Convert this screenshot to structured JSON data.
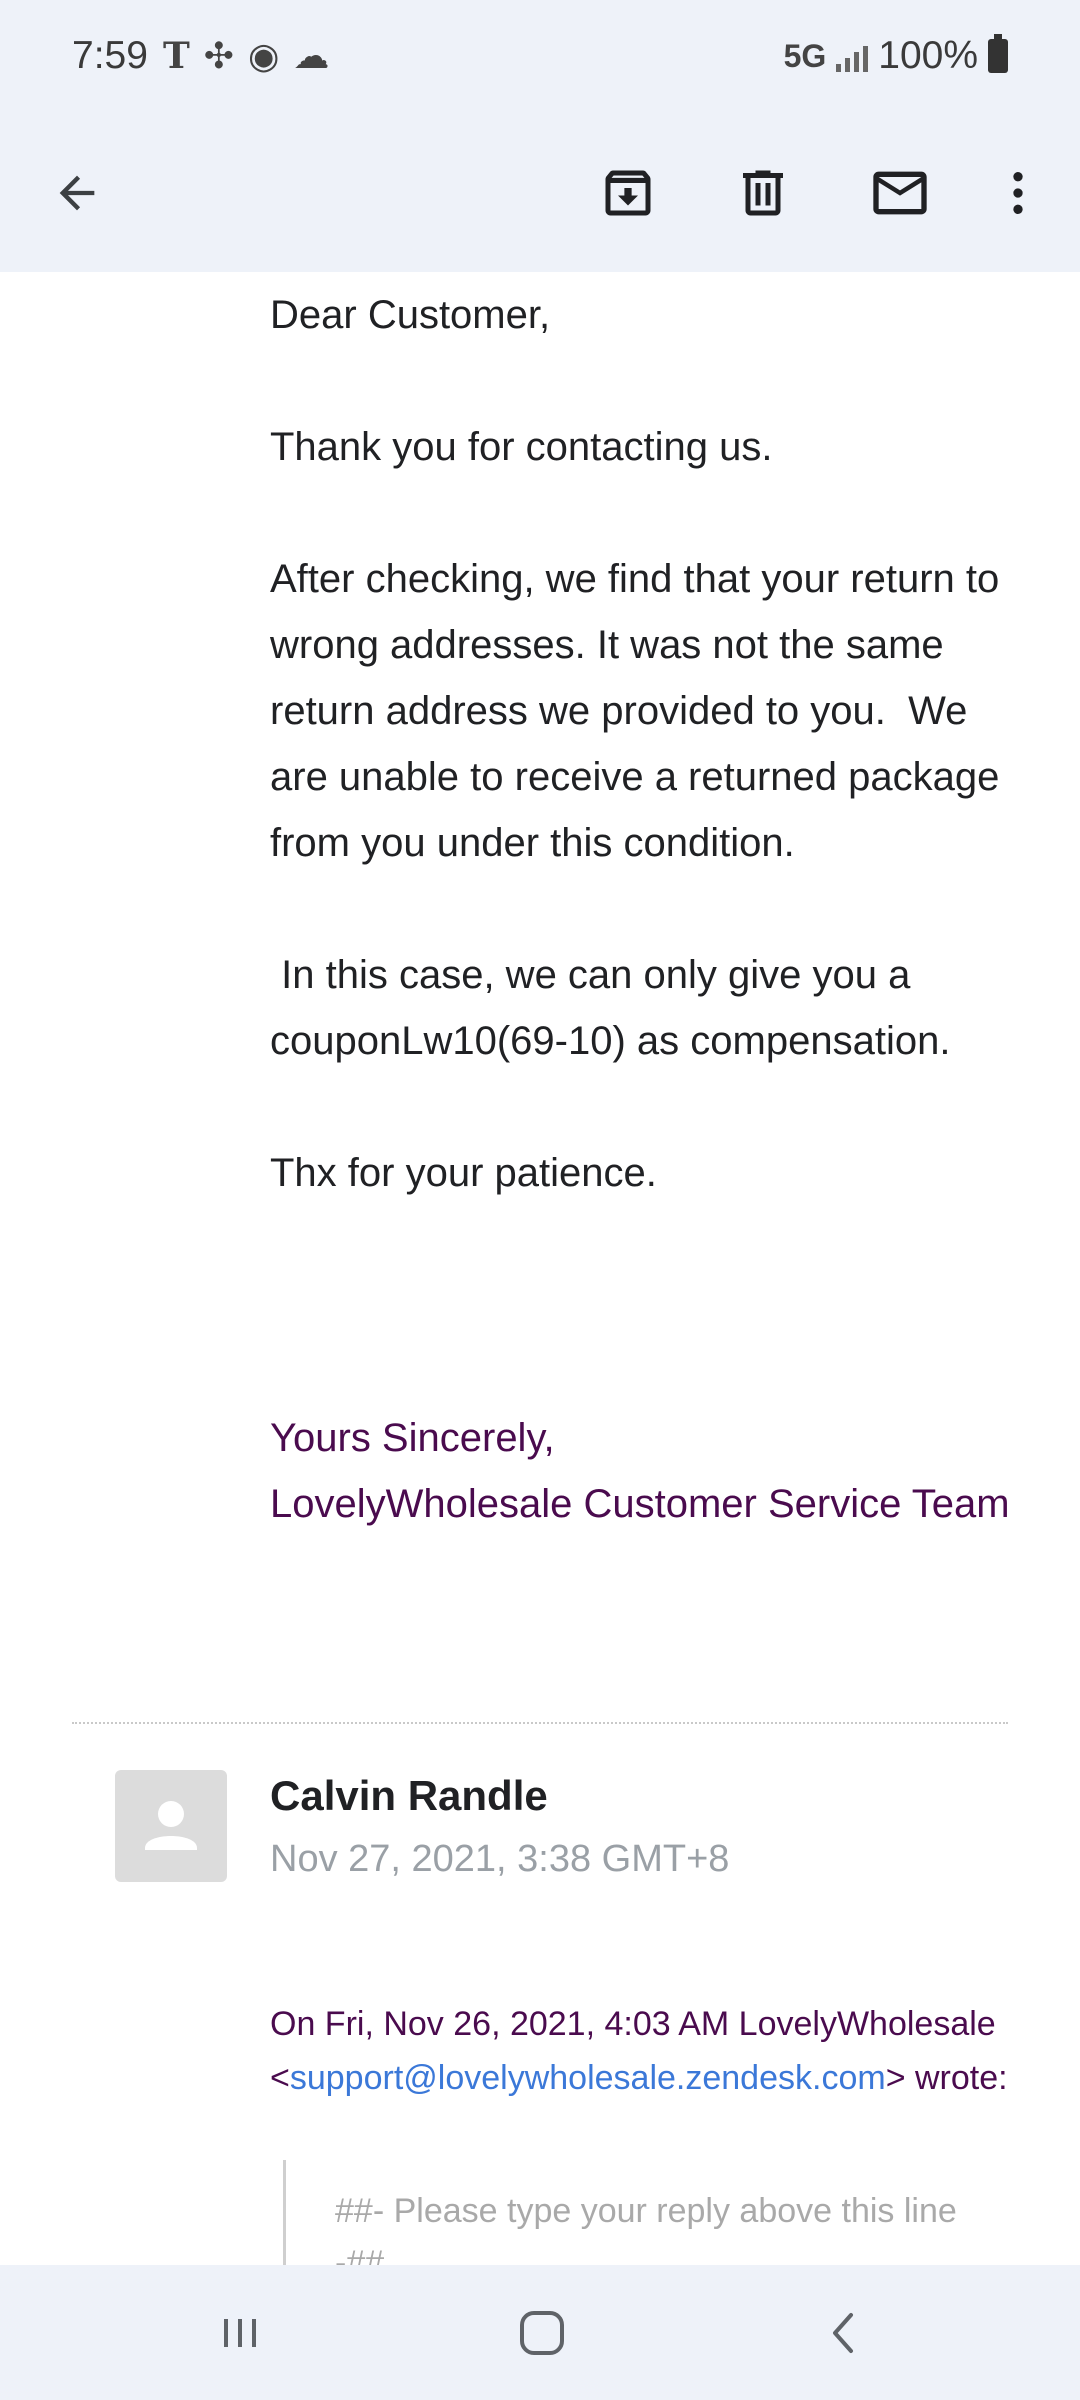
{
  "status_bar": {
    "time": "7:59",
    "network": "5G",
    "battery": "100%",
    "icons": [
      "t-mobile-icon",
      "pinwheel-icon",
      "chrome-icon",
      "cloud-icon"
    ]
  },
  "toolbar": {
    "icons": [
      "back-arrow-icon",
      "archive-icon",
      "delete-icon",
      "mark-unread-icon",
      "more-options-icon"
    ]
  },
  "message": {
    "paragraphs": [
      "Dear Customer,",
      "Thank you for contacting us.",
      "After checking, we find that your return to wrong addresses. It was not the same return address we provided to you.  We are unable to receive a returned package from you under this condition.",
      " In this case, we can only give you a couponLw10(69-10) as compensation.",
      "Thx for your patience."
    ],
    "signature": {
      "line1": "Yours Sincerely,",
      "line2": "LovelyWholesale Customer Service Team"
    }
  },
  "next_message": {
    "sender": "Calvin Randle",
    "date": "Nov 27, 2021, 3:38 GMT+8",
    "quote_intro_prefix": "On Fri, Nov 26, 2021, 4:03 AM LovelyWholesale <",
    "quote_email": "support@lovelywholesale.zendesk.com",
    "quote_intro_suffix": "> wrote:",
    "quote_text": "##- Please type your reply above this line -##"
  },
  "colors": {
    "chrome_bg": "#eef2f9",
    "signature": "#4a0b4e",
    "link": "#3b78d8",
    "muted": "#9aa0a6"
  }
}
